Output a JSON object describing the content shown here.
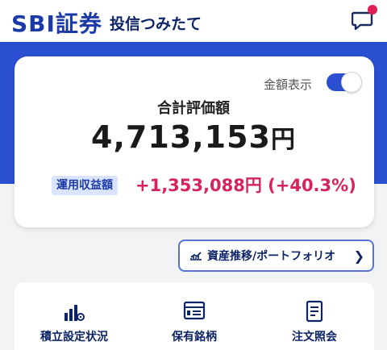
{
  "header": {
    "brand": "SBI証券",
    "service": "投信つみたて",
    "message_icon": "chat-bubble-icon",
    "badge_color": "#e02055"
  },
  "summary": {
    "toggle_label": "金額表示",
    "toggle_on": true,
    "total_label": "合計評価額",
    "total_amount": "4,713,153",
    "currency": "円",
    "gain_label": "運用収益額",
    "gain_value": "+1,353,088円 (+40.3%)"
  },
  "portfolio_button": {
    "icon": "trend-chart-icon",
    "label": "資産推移/ポートフォリオ"
  },
  "menu": [
    {
      "icon": "bar-chart-gear-icon",
      "label": "積立設定状況"
    },
    {
      "icon": "holdings-list-icon",
      "label": "保有銘柄"
    },
    {
      "icon": "order-document-icon",
      "label": "注文照会"
    }
  ],
  "colors": {
    "brand_blue": "#2b4fd1",
    "navy": "#0d2466",
    "gain_red": "#d6245a"
  }
}
